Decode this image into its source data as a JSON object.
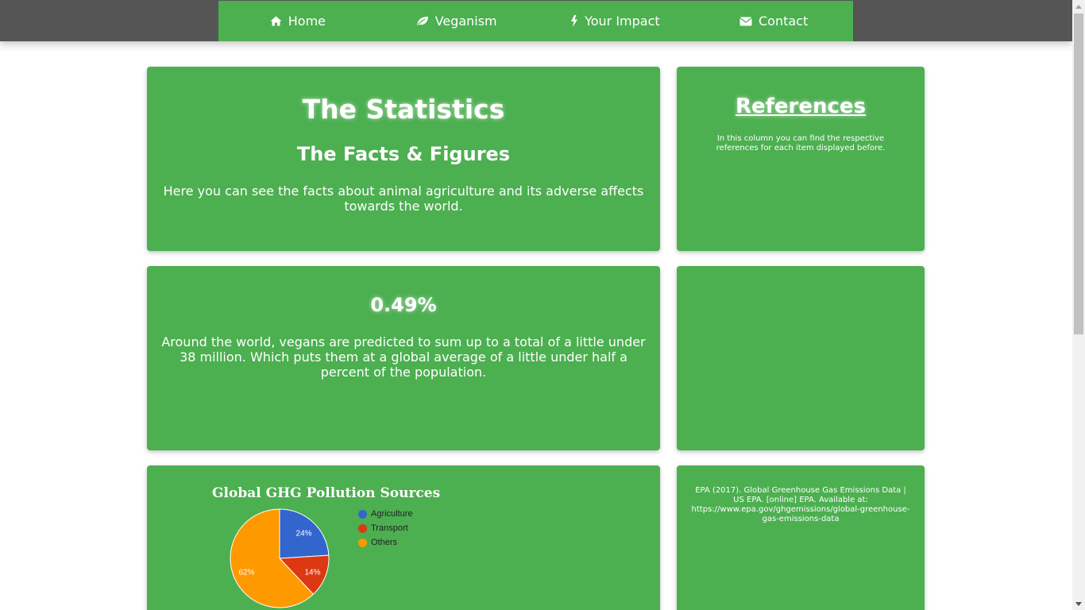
{
  "nav": {
    "items": [
      {
        "label": "Home",
        "icon": "home-icon"
      },
      {
        "label": "Veganism",
        "icon": "leaf-icon"
      },
      {
        "label": "Your Impact",
        "icon": "bolt-icon"
      },
      {
        "label": "Contact",
        "icon": "envelope-icon"
      }
    ]
  },
  "stats_card": {
    "title": "The Statistics",
    "subtitle": "The Facts & Figures",
    "description": "Here you can see the facts about animal agriculture and its adverse affects towards the world."
  },
  "references_card": {
    "title": "References",
    "description": "In this column you can find the respective references for each item displayed before."
  },
  "vegan_card": {
    "value": "0.49%",
    "description": "Around the world, vegans are predicted to sum up to a total of a little under 38 million. Which puts them at a global average of a little under half a percent of the population."
  },
  "epa_reference": "EPA (2017). Global Greenhouse Gas Emissions Data | US EPA. [online] EPA. Available at: https://www.epa.gov/ghgemissions/global-greenhouse-gas-emissions-data",
  "colors": {
    "green": "#4caf50",
    "dark_bar": "#555555",
    "agriculture": "#3366cc",
    "transport": "#dc3912",
    "others": "#ff9900"
  },
  "chart_data": {
    "type": "pie",
    "title": "Global GHG Pollution Sources",
    "categories": [
      "Agriculture",
      "Transport",
      "Others"
    ],
    "values": [
      24,
      14,
      62
    ],
    "labels": [
      "24%",
      "14%",
      "62%"
    ],
    "colors": [
      "#3366cc",
      "#dc3912",
      "#ff9900"
    ],
    "legend": "right"
  }
}
